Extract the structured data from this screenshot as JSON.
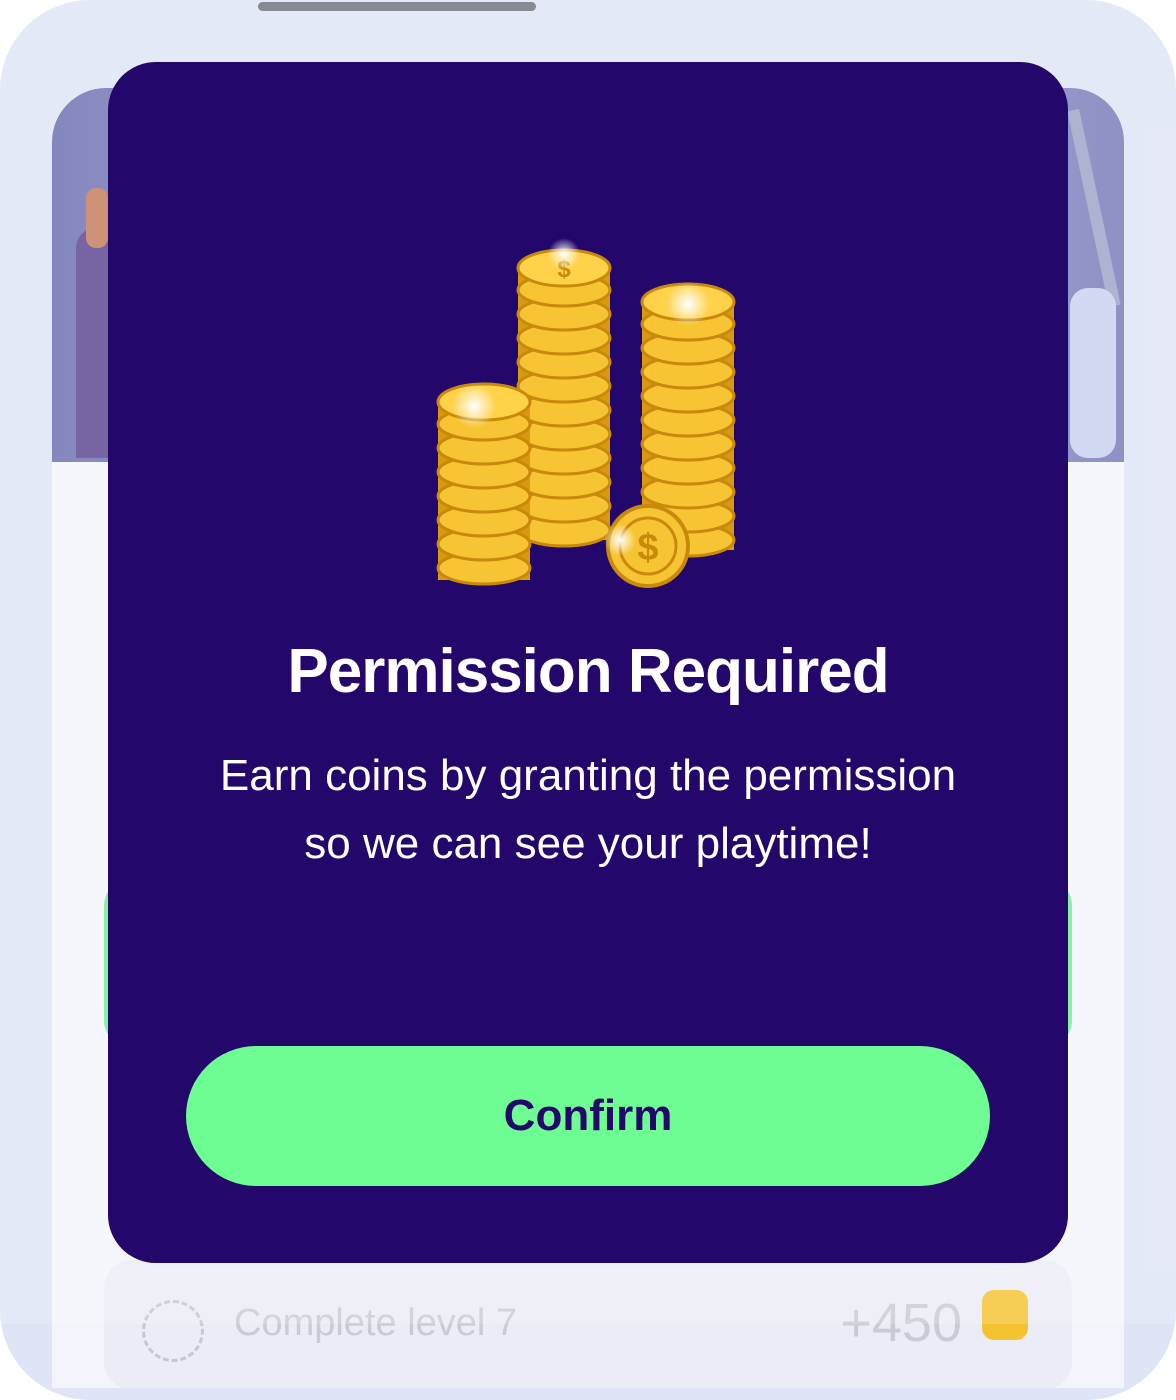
{
  "modal": {
    "title": "Permission Required",
    "body": "Earn coins by granting the permission so we can see your playtime!",
    "confirm_label": "Confirm",
    "illustration": "gold-coin-stacks-icon"
  },
  "background_task": {
    "label": "Complete level 7",
    "reward": "+450",
    "reward_icon": "coin-icon"
  },
  "colors": {
    "modal_background": "#23076b",
    "confirm_button": "#6dfd93",
    "confirm_text": "#23076b",
    "title_text": "#ffffff",
    "screen_background": "#f4f4fd",
    "frame": "#dfe4f6"
  }
}
